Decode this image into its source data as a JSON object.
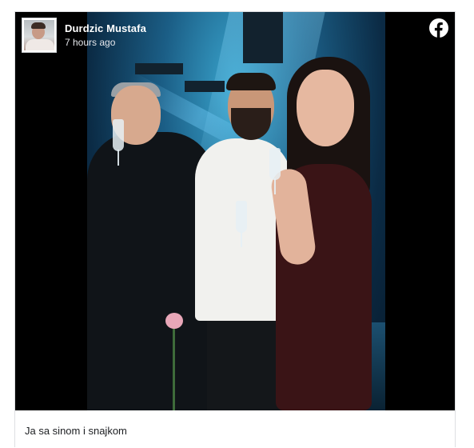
{
  "post": {
    "author_name": "Durdzic Mustafa",
    "timestamp": "7 hours ago",
    "caption": "Ja sa sinom i snajkom"
  },
  "icons": {
    "platform": "facebook-icon",
    "avatar": "profile-photo"
  },
  "colors": {
    "facebook_brand": "#ffffff",
    "media_background": "#000000",
    "caption_text": "#1c1e21"
  }
}
